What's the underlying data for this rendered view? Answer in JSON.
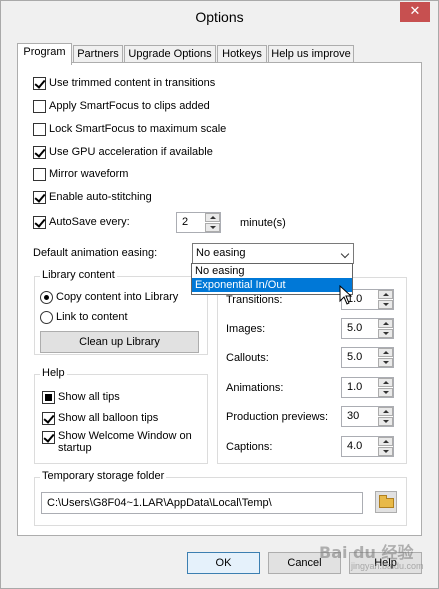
{
  "window": {
    "title": "Options",
    "close_glyph": "✕"
  },
  "tabs": [
    {
      "label": "Program",
      "active": true
    },
    {
      "label": "Partners"
    },
    {
      "label": "Upgrade Options"
    },
    {
      "label": "Hotkeys"
    },
    {
      "label": "Help us improve"
    }
  ],
  "options": {
    "use_trimmed": {
      "label": "Use trimmed content in transitions",
      "checked": true
    },
    "apply_smartfocus": {
      "label": "Apply SmartFocus to clips added",
      "checked": false
    },
    "lock_smartfocus": {
      "label": "Lock SmartFocus to maximum scale",
      "checked": false
    },
    "gpu": {
      "label": "Use GPU acceleration if available",
      "checked": true
    },
    "mirror": {
      "label": "Mirror waveform",
      "checked": false
    },
    "autostitch": {
      "label": "Enable auto-stitching",
      "checked": true
    },
    "autosave": {
      "label": "AutoSave every:",
      "checked": true,
      "value": "2",
      "unit": "minute(s)"
    }
  },
  "easing": {
    "label": "Default animation easing:",
    "selected": "No easing",
    "options": [
      "No easing",
      "Exponential In/Out"
    ],
    "highlighted": "Exponential In/Out"
  },
  "library": {
    "title": "Library content",
    "copy_label": "Copy content into Library",
    "link_label": "Link to content",
    "cleanup_label": "Clean up Library"
  },
  "durations": {
    "rows": [
      {
        "label": "Transitions:",
        "value": "1.0"
      },
      {
        "label": "Images:",
        "value": "5.0"
      },
      {
        "label": "Callouts:",
        "value": "5.0"
      },
      {
        "label": "Animations:",
        "value": "1.0"
      },
      {
        "label": "Production previews:",
        "value": "30"
      },
      {
        "label": "Captions:",
        "value": "4.0"
      }
    ]
  },
  "help": {
    "title": "Help",
    "show_all_tips": "Show all tips",
    "show_balloon": "Show all balloon tips",
    "show_welcome_1": "Show Welcome Window on",
    "show_welcome_2": "startup"
  },
  "temp": {
    "title": "Temporary storage folder",
    "path": "C:\\Users\\G8F04~1.LAR\\AppData\\Local\\Temp\\"
  },
  "buttons": {
    "ok": "OK",
    "cancel": "Cancel",
    "help": "Help"
  },
  "watermark": {
    "text": "Bai du 经验",
    "sub": "jingyan.baidu.com"
  }
}
